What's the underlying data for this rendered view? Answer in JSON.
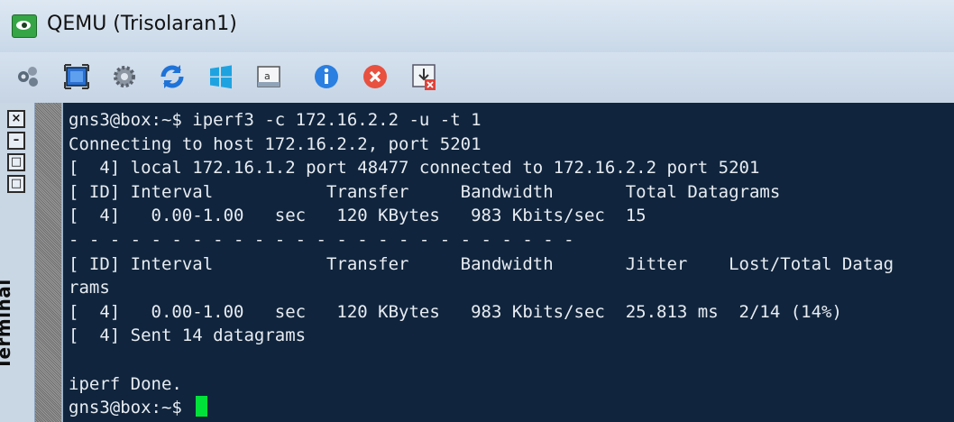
{
  "window": {
    "title": "QEMU (Trisolaran1)"
  },
  "toolbar": {
    "items": [
      {
        "name": "network-icon"
      },
      {
        "name": "fullscreen-icon"
      },
      {
        "name": "settings-gear-icon"
      },
      {
        "name": "reload-icon"
      },
      {
        "name": "windows-icon"
      },
      {
        "name": "console-icon"
      },
      {
        "name": "info-icon"
      },
      {
        "name": "stop-icon"
      },
      {
        "name": "save-exit-icon"
      }
    ]
  },
  "side_tab": {
    "label": "Terminal",
    "buttons": [
      "×",
      "–",
      "□",
      "□"
    ]
  },
  "terminal": {
    "lines": [
      "gns3@box:~$ iperf3 -c 172.16.2.2 -u -t 1",
      "Connecting to host 172.16.2.2, port 5201",
      "[  4] local 172.16.1.2 port 48477 connected to 172.16.2.2 port 5201",
      "[ ID] Interval           Transfer     Bandwidth       Total Datagrams",
      "[  4]   0.00-1.00   sec   120 KBytes   983 Kbits/sec  15",
      "- - - - - - - - - - - - - - - - - - - - - - - - -",
      "[ ID] Interval           Transfer     Bandwidth       Jitter    Lost/Total Datag",
      "rams",
      "[  4]   0.00-1.00   sec   120 KBytes   983 Kbits/sec  25.813 ms  2/14 (14%)",
      "[  4] Sent 14 datagrams",
      "",
      "iperf Done.",
      "gns3@box:~$ "
    ]
  }
}
